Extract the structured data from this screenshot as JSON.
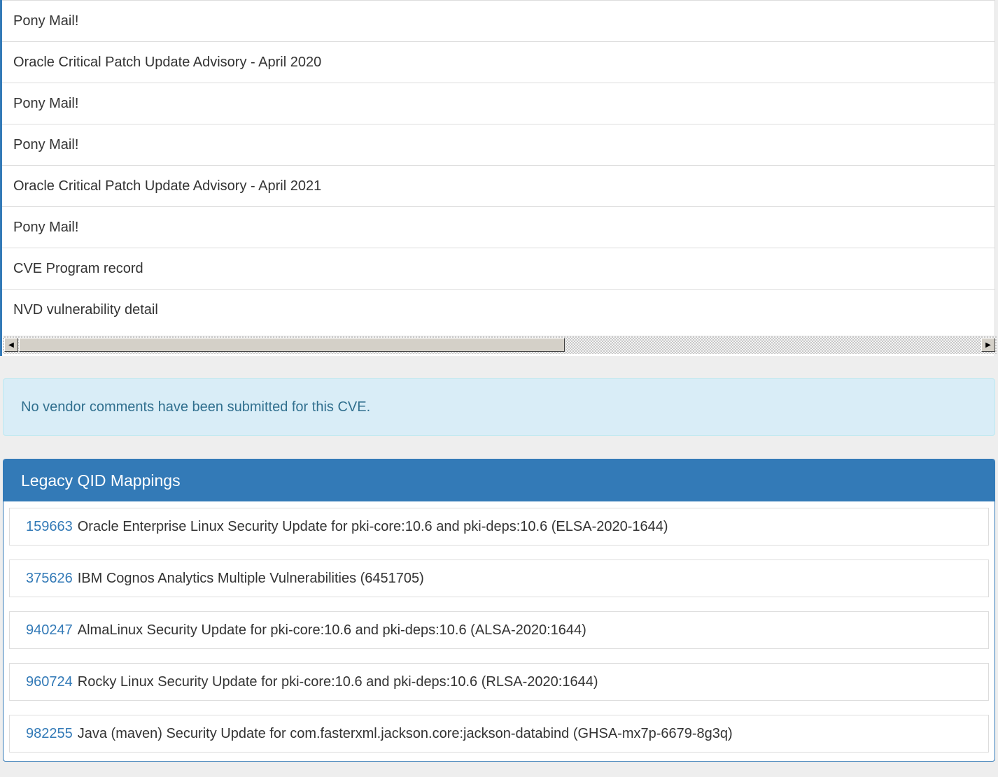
{
  "references": [
    "Pony Mail!",
    "Oracle Critical Patch Update Advisory - April 2020",
    "Pony Mail!",
    "Pony Mail!",
    "Oracle Critical Patch Update Advisory - April 2021",
    "Pony Mail!",
    "CVE Program record",
    "NVD vulnerability detail"
  ],
  "scrollbar": {
    "left_arrow": "◀",
    "right_arrow": "▶"
  },
  "vendor_comments": {
    "message": "No vendor comments have been submitted for this CVE."
  },
  "legacy_qid": {
    "title": "Legacy QID Mappings",
    "items": [
      {
        "qid": "159663",
        "description": "Oracle Enterprise Linux Security Update for pki-core:10.6 and pki-deps:10.6 (ELSA-2020-1644)"
      },
      {
        "qid": "375626",
        "description": "IBM Cognos Analytics Multiple Vulnerabilities (6451705)"
      },
      {
        "qid": "940247",
        "description": "AlmaLinux Security Update for pki-core:10.6 and pki-deps:10.6 (ALSA-2020:1644)"
      },
      {
        "qid": "960724",
        "description": "Rocky Linux Security Update for pki-core:10.6 and pki-deps:10.6 (RLSA-2020:1644)"
      },
      {
        "qid": "982255",
        "description": "Java (maven) Security Update for com.fasterxml.jackson.core:jackson-databind (GHSA-mx7p-6679-8g3q)"
      }
    ]
  }
}
